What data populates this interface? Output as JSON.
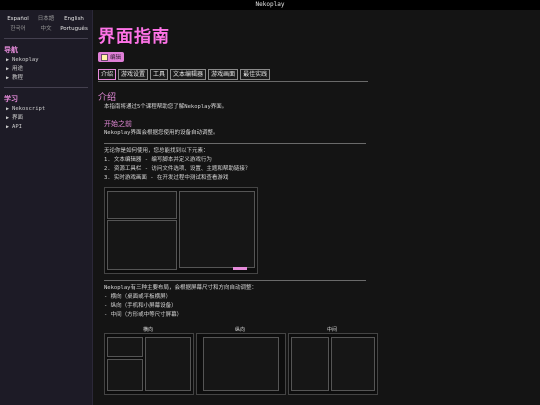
{
  "window": {
    "title": "Nekoplay"
  },
  "sidebar": {
    "languages_row1": [
      "Español",
      "日本語",
      "English"
    ],
    "languages_row2": [
      "한국어",
      "中文",
      "Português"
    ],
    "nav_title": "导航",
    "nav_items": [
      "Nekoplay",
      "用途",
      "教程"
    ],
    "learn_title": "学习",
    "learn_items": [
      "Nekoscript",
      "界面",
      "API"
    ]
  },
  "main": {
    "page_title": "界面指南",
    "edit_label": "编辑",
    "tabs": [
      "介绍",
      "游戏设置",
      "工具",
      "文本编辑器",
      "游戏画面",
      "最佳实践"
    ],
    "intro_heading": "介绍",
    "intro_text": "本指南将通过5个课程帮助您了解Nekoplay界面。",
    "start_heading": "开始之前",
    "start_text": "Nekoplay界面会根据您使用的设备自动调整。",
    "components_intro": "无论你是如何使用，您总能找到以下元素：",
    "components": [
      "1. 文本编辑器 - 编写脚本并定义游戏行为",
      "2. 资源工具栏 - 访问文件选项、设置、主题和帮助链接？",
      "3. 实时游戏画面 - 在开发过程中测试和查看游戏"
    ],
    "layouts_intro": "Nekoplay有三种主要布局，会根据屏幕尺寸和方向自动调整：",
    "layouts": [
      "- 横向（桌面或平板横屏）",
      "- 纵向（手机和小屏幕设备）",
      "- 中间（方形或中等尺寸屏幕）"
    ],
    "layout_labels": [
      "横向",
      "纵向",
      "中间"
    ]
  }
}
